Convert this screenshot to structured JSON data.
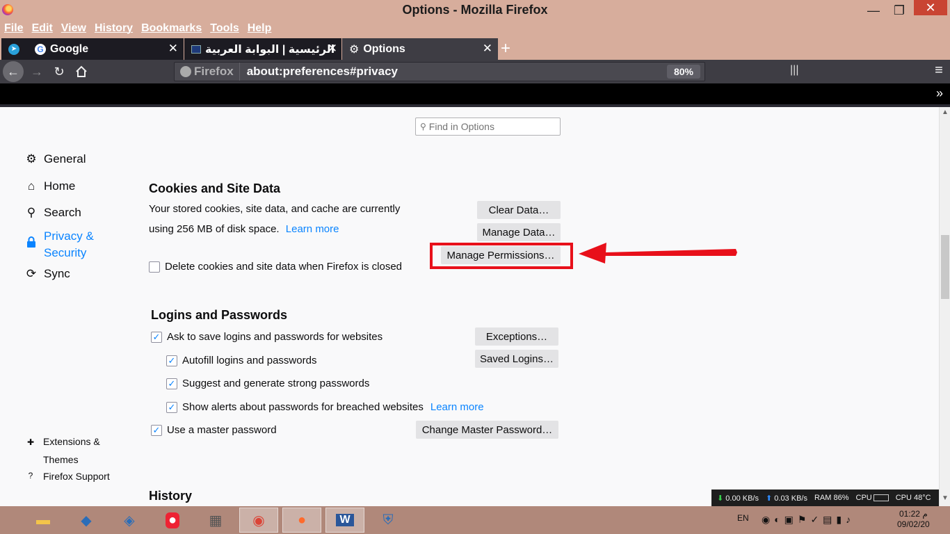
{
  "window": {
    "title": "Options - Mozilla Firefox",
    "minimize_glyph": "—",
    "maximize_glyph": "❐",
    "close_glyph": "✕"
  },
  "menu": [
    "File",
    "Edit",
    "View",
    "History",
    "Bookmarks",
    "Tools",
    "Help"
  ],
  "tabs": {
    "google": {
      "label": "Google",
      "icon": "G"
    },
    "arabic": {
      "label": "الرئيسية | البوابة العربية"
    },
    "options": {
      "label": "Options"
    },
    "close_glyph": "✕",
    "new_tab_glyph": "+"
  },
  "navbar": {
    "identity_label": "Firefox",
    "url": "about:preferences#privacy",
    "zoom": "80%"
  },
  "search": {
    "placeholder": "Find in Options"
  },
  "sidebar": {
    "general": "General",
    "home": "Home",
    "search": "Search",
    "privacy_line1": "Privacy &",
    "privacy_line2": "Security",
    "sync": "Sync",
    "extensions_line1": "Extensions &",
    "extensions_line2": "Themes",
    "support": "Firefox Support"
  },
  "cookies": {
    "title": "Cookies and Site Data",
    "desc_line1": "Your stored cookies, site data, and cache are currently",
    "desc_line2": "using 256 MB of disk space.",
    "learn_more": "Learn more",
    "clear_data": "Clear Data…",
    "manage_data": "Manage Data…",
    "manage_permissions": "Manage Permissions…",
    "delete_on_close": "Delete cookies and site data when Firefox is closed",
    "delete_on_close_checked": false
  },
  "logins": {
    "title": "Logins and Passwords",
    "ask_to_save": "Ask to save logins and passwords for websites",
    "exceptions": "Exceptions…",
    "autofill": "Autofill logins and passwords",
    "saved_logins": "Saved Logins…",
    "suggest": "Suggest and generate strong passwords",
    "alerts": "Show alerts about passwords for breached websites",
    "alerts_learn_more": "Learn more",
    "master_password": "Use a master password",
    "change_master": "Change Master Password…",
    "check_glyph": "✓"
  },
  "history": {
    "title": "History"
  },
  "annotation": {
    "box_color": "#e8101a",
    "arrow_color": "#e8101a"
  },
  "netmon": {
    "down": "0.00 KB/s",
    "up": "0.03 KB/s",
    "ram": "RAM 86%",
    "cpu_label": "CPU",
    "cpu_temp": "CPU 48°C"
  },
  "tray": {
    "lang": "EN",
    "time": "01:22 م",
    "date": "09/02/20"
  },
  "colors": {
    "accent": "#0a84ff",
    "titlebar": "#d7ad9c",
    "toolbar": "#3e3d44",
    "taskbar": "#b0887a"
  }
}
